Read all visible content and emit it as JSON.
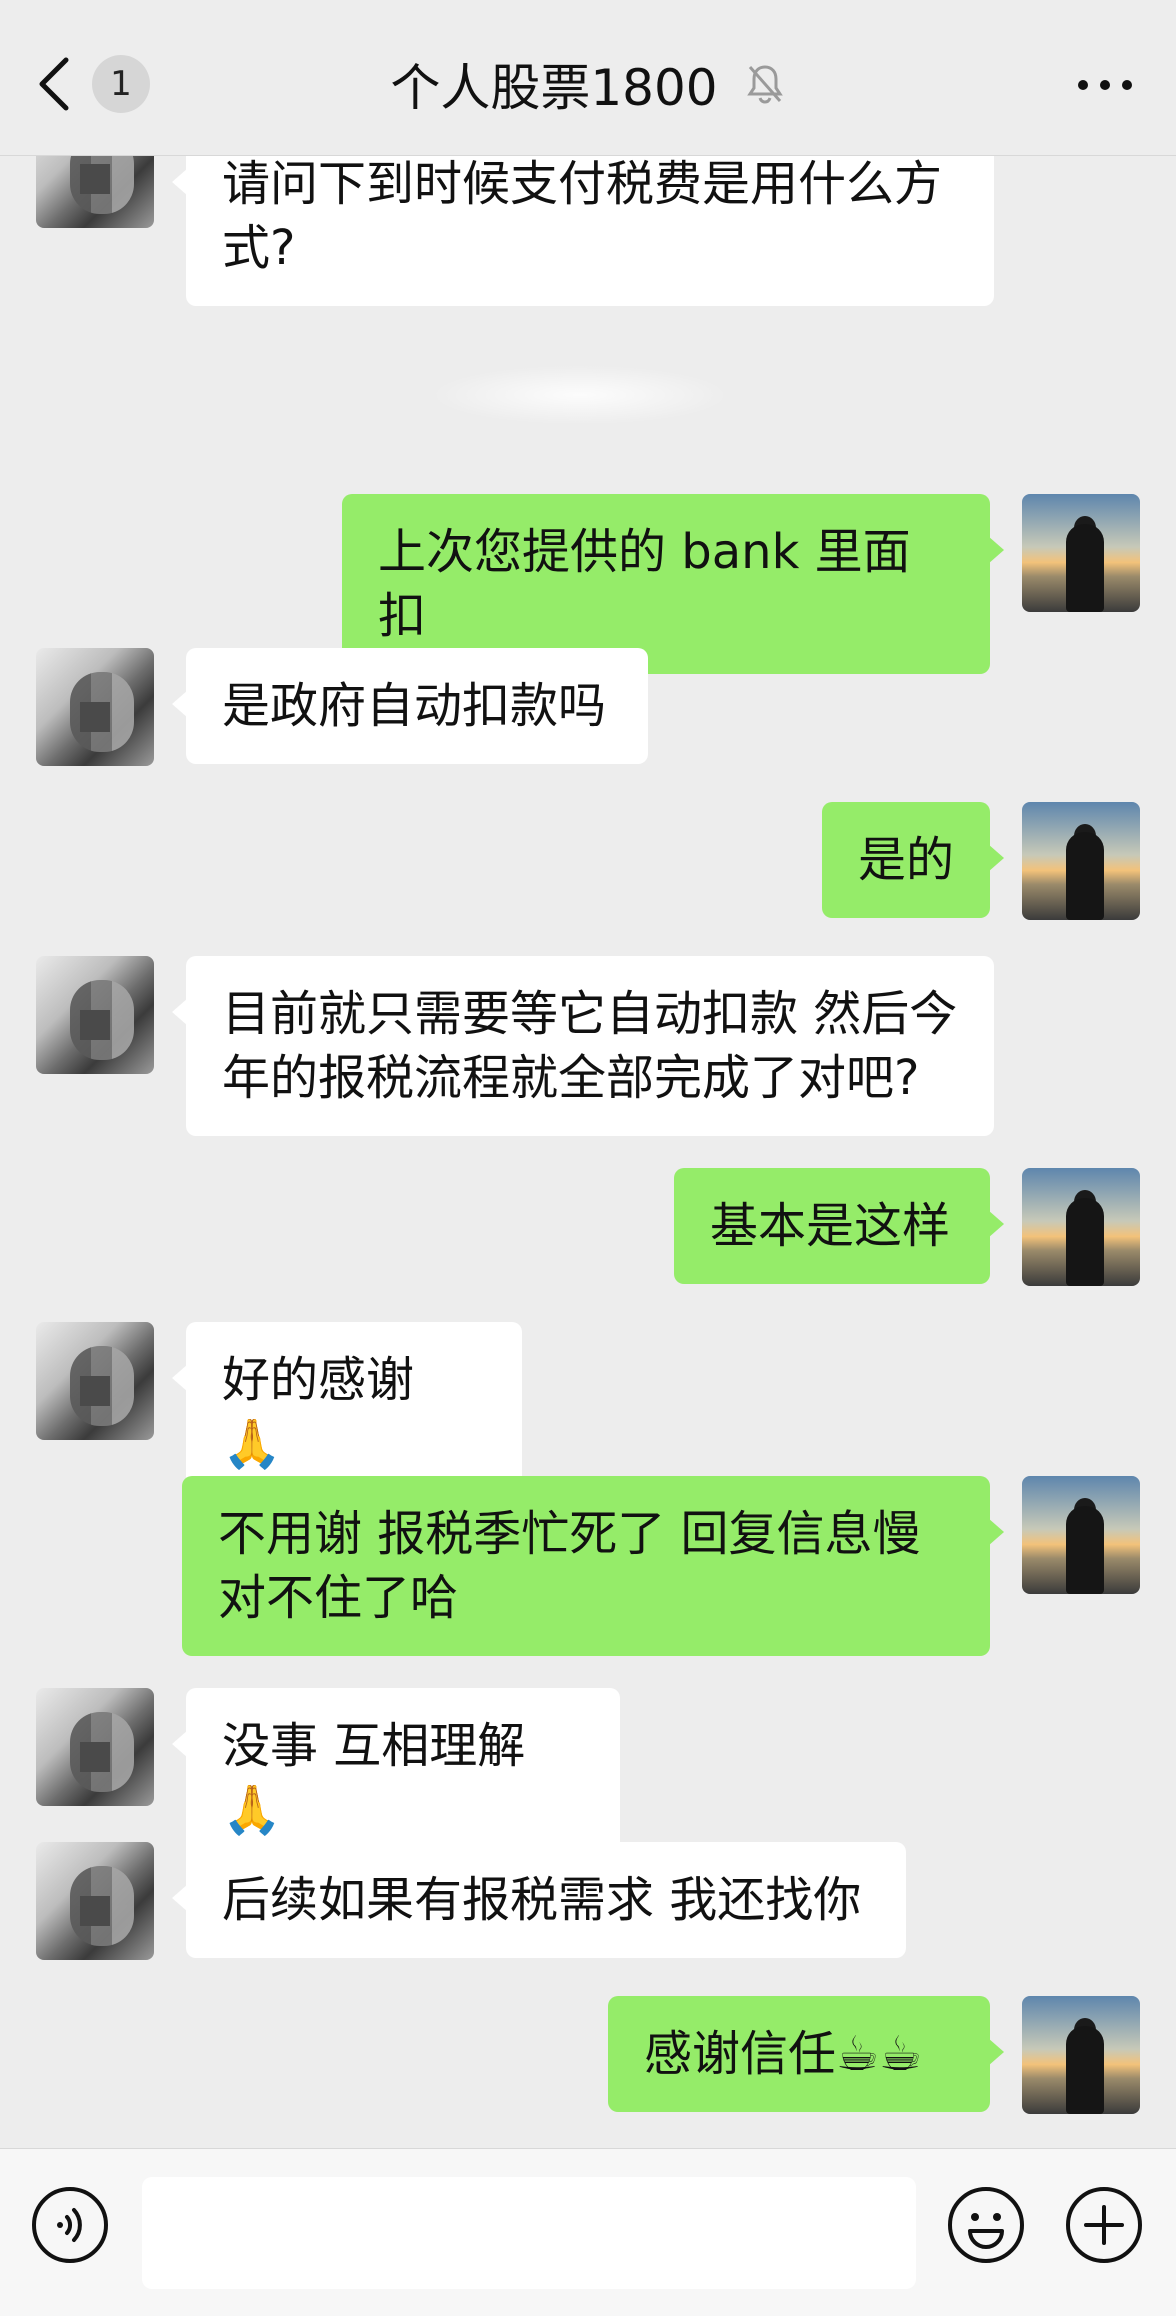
{
  "header": {
    "unread_count": "1",
    "title": "个人股票1800"
  },
  "messages": [
    {
      "side": "left",
      "text": "请问下到时候支付税费是用什么方\n式?"
    },
    {
      "side": "right",
      "text": "上次您提供的 bank 里面扣"
    },
    {
      "side": "left",
      "text": "是政府自动扣款吗"
    },
    {
      "side": "right",
      "text": "是的"
    },
    {
      "side": "left",
      "text": "目前就只需要等它自动扣款 然后今\n年的报税流程就全部完成了对吧?"
    },
    {
      "side": "right",
      "text": "基本是这样"
    },
    {
      "side": "left",
      "text": "好的感谢 🙏"
    },
    {
      "side": "right",
      "text": "不用谢 报税季忙死了 回复信息慢\n对不住了哈"
    },
    {
      "side": "left",
      "text": "没事 互相理解🙏"
    },
    {
      "side": "left",
      "text": "后续如果有报税需求 我还找你"
    },
    {
      "side": "right",
      "text": "感谢信任☕☕"
    }
  ],
  "input_bar": {
    "placeholder": ""
  },
  "icons": {
    "back": "chevron-left-icon",
    "mute": "bell-off-icon",
    "more": "more-dots-icon",
    "voice": "voice-icon",
    "emoji": "emoji-icon",
    "plus": "plus-icon"
  },
  "colors": {
    "background": "#ededed",
    "bubble_self": "#95ec69",
    "bubble_other": "#ffffff"
  }
}
